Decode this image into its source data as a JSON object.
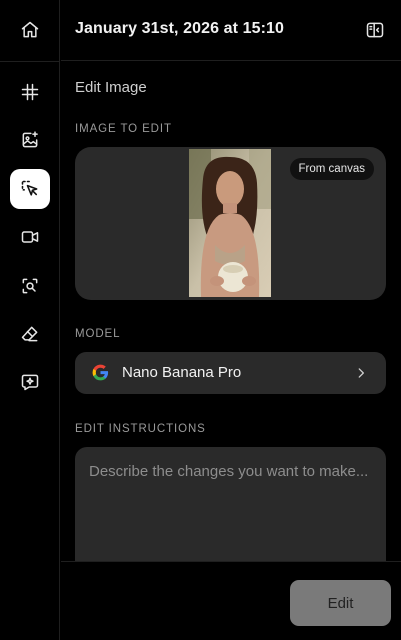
{
  "header": {
    "title": "January 31st, 2026 at 15:10",
    "panel_icon": "sidebar-panel-icon"
  },
  "sidebar": {
    "items": [
      {
        "name": "home",
        "icon": "home-icon",
        "active": false
      },
      {
        "name": "grid",
        "icon": "hash-icon",
        "active": false
      },
      {
        "name": "image-generate",
        "icon": "image-sparkle-icon",
        "active": false
      },
      {
        "name": "image-edit",
        "icon": "cursor-select-icon",
        "active": true
      },
      {
        "name": "video",
        "icon": "video-icon",
        "active": false
      },
      {
        "name": "image-search",
        "icon": "zoom-image-icon",
        "active": false
      },
      {
        "name": "eraser",
        "icon": "eraser-icon",
        "active": false
      },
      {
        "name": "chat",
        "icon": "sparkle-chat-icon",
        "active": false
      }
    ]
  },
  "main": {
    "title": "Edit Image",
    "image_section": {
      "label": "IMAGE TO EDIT",
      "badge": "From canvas"
    },
    "model_section": {
      "label": "MODEL",
      "model_name": "Nano Banana Pro",
      "provider_icon": "google-icon"
    },
    "instructions_section": {
      "label": "EDIT INSTRUCTIONS",
      "placeholder": "Describe the changes you want to make...",
      "value": ""
    }
  },
  "footer": {
    "edit_label": "Edit"
  },
  "colors": {
    "background": "#000000",
    "card": "#2a2a2a",
    "active_nav": "#ffffff",
    "button_disabled": "#7a7a7a",
    "label": "#9a9a9a"
  }
}
